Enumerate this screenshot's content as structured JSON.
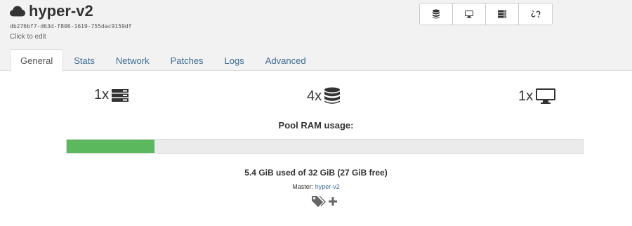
{
  "header": {
    "title": "hyper-v2",
    "uuid": "db276bf7-d63d-f806-1619-755dac9159df",
    "edit_hint": "Click to edit",
    "toolbar": [
      {
        "icon": "database-icon"
      },
      {
        "icon": "desktop-icon"
      },
      {
        "icon": "server-icon"
      },
      {
        "icon": "unlink-icon"
      }
    ]
  },
  "tabs": [
    {
      "label": "General",
      "active": true
    },
    {
      "label": "Stats"
    },
    {
      "label": "Network"
    },
    {
      "label": "Patches"
    },
    {
      "label": "Logs"
    },
    {
      "label": "Advanced"
    }
  ],
  "summary": {
    "hosts": "1x",
    "storages": "4x",
    "vms": "1x"
  },
  "ram": {
    "label": "Pool RAM usage:",
    "used_fraction": 0.17,
    "usage_text": "5.4 GiB used of 32 GiB (27 GiB free)",
    "master_label": "Master:",
    "master_value": "hyper-v2"
  },
  "colors": {
    "accent_link": "#3c6b93",
    "bar_fill": "#5cb85c"
  }
}
